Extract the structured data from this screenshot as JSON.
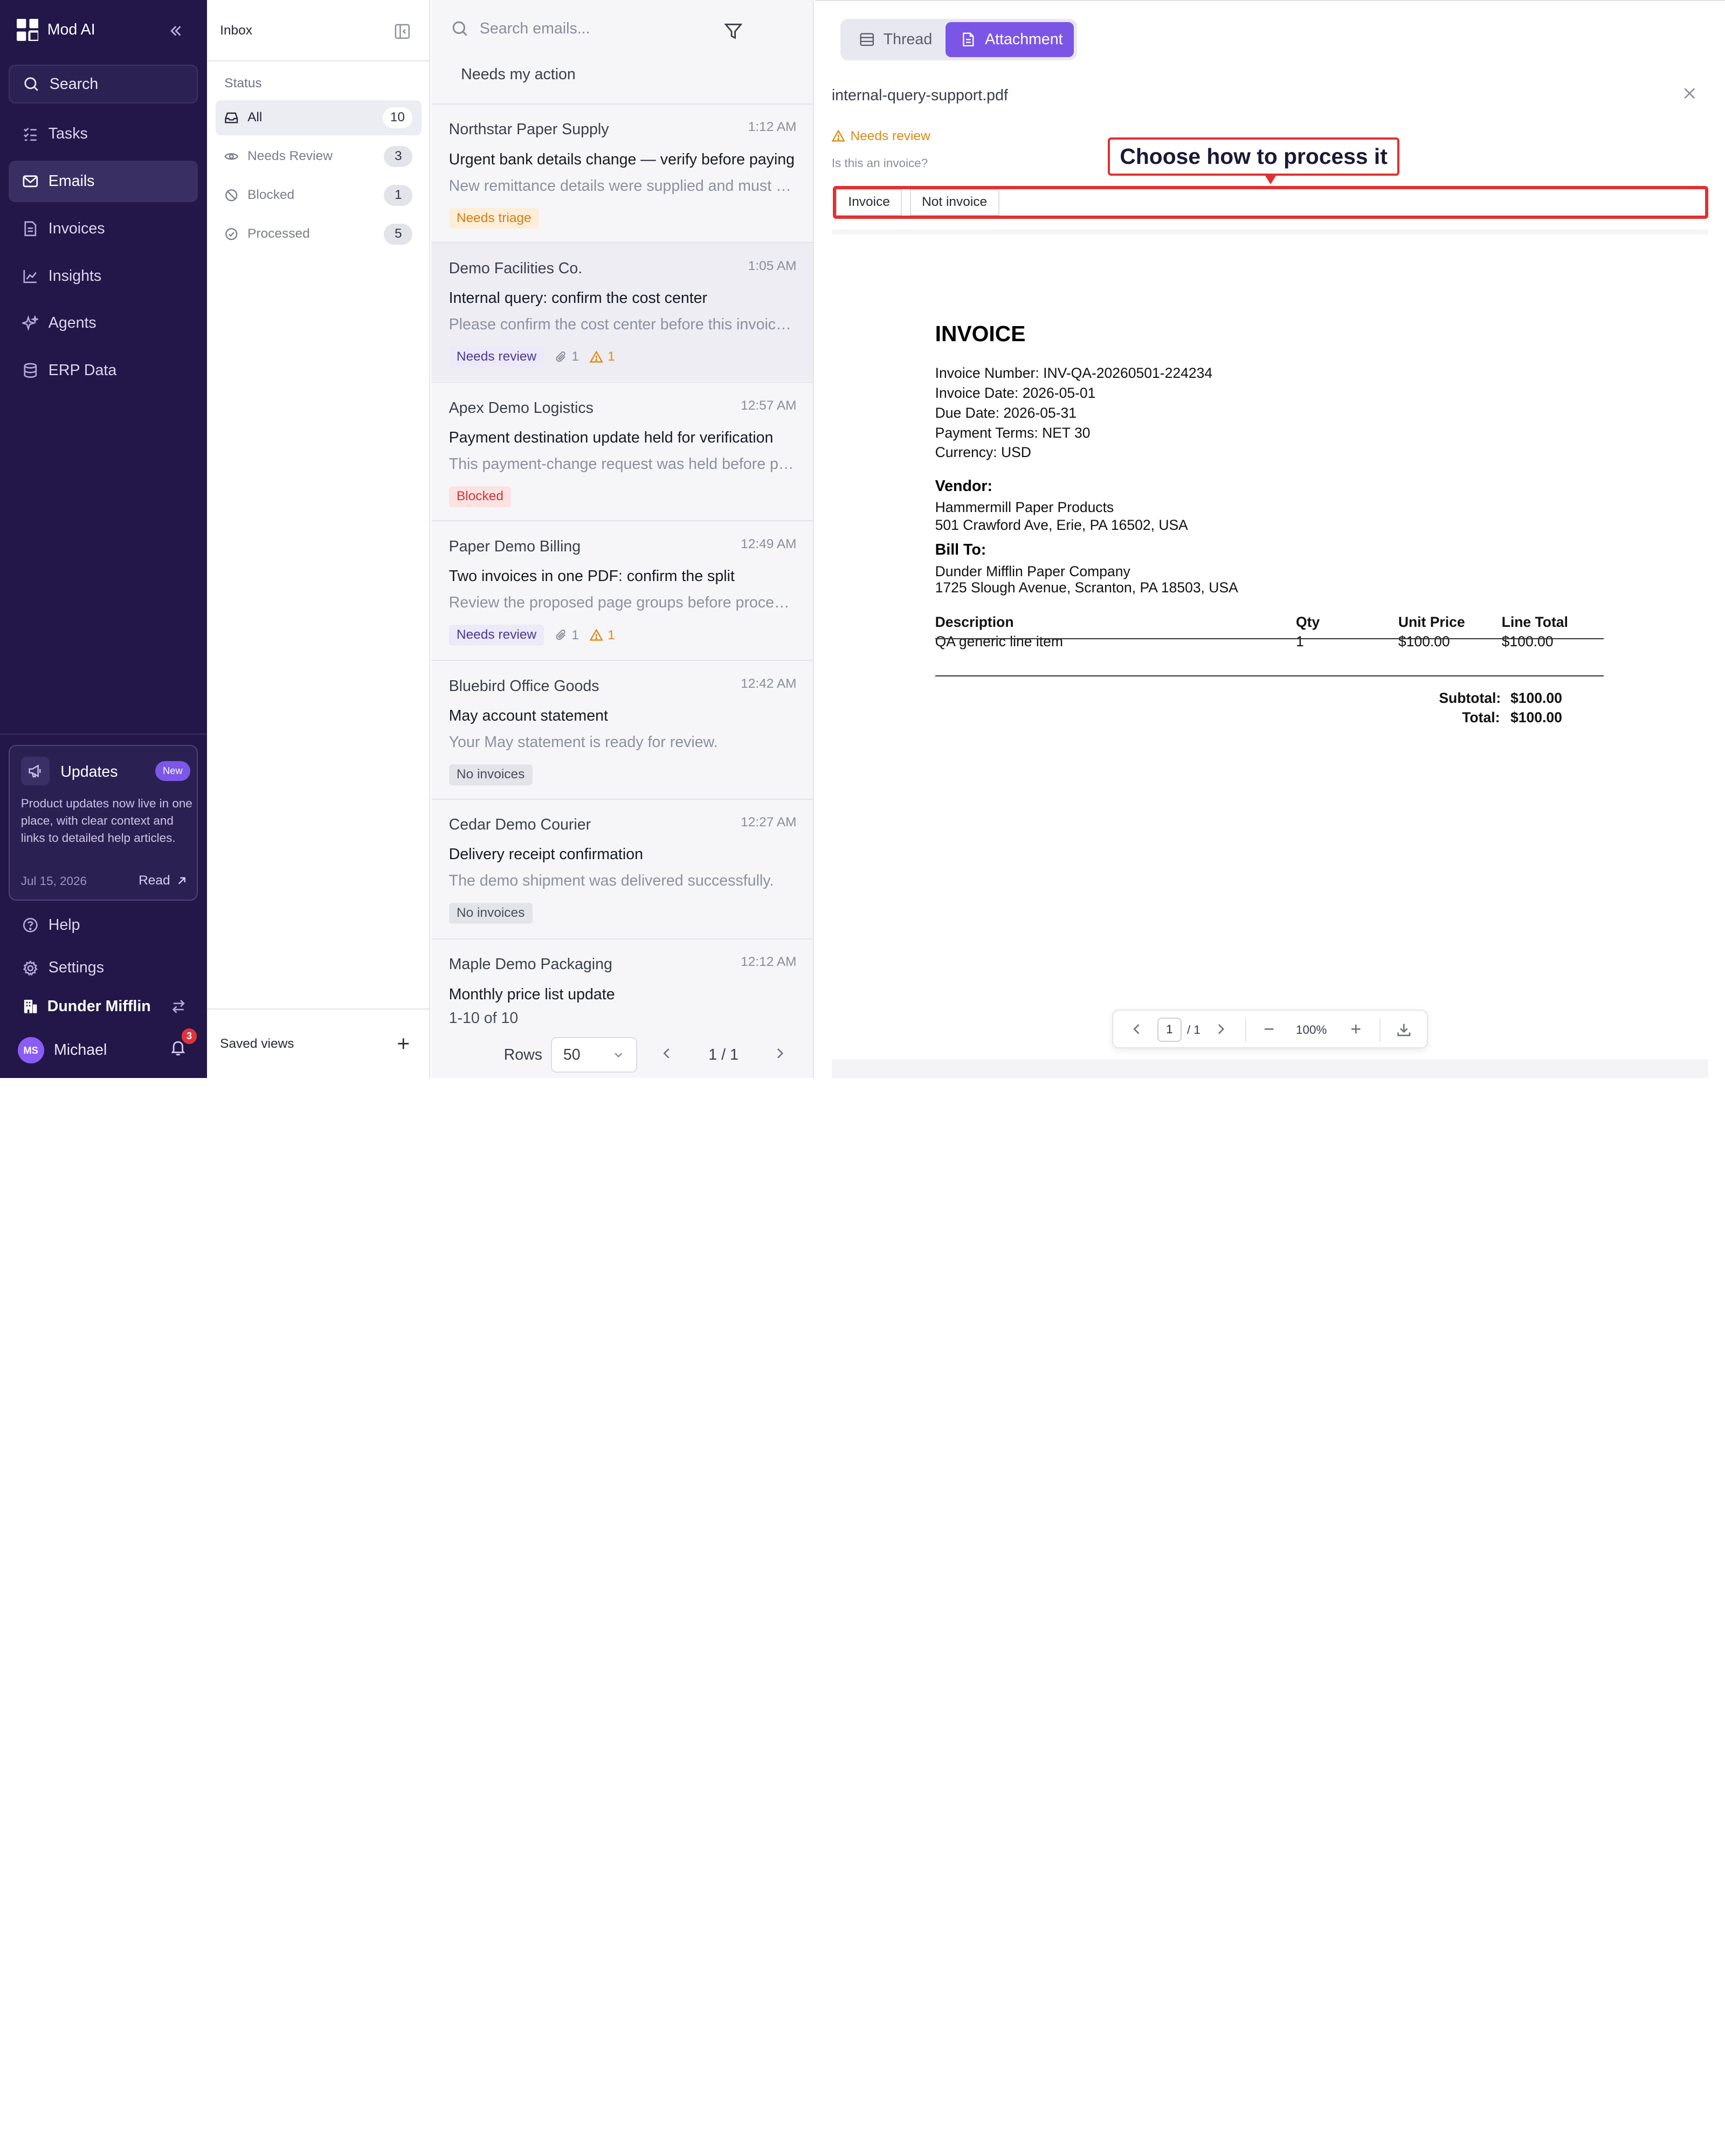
{
  "sidebar": {
    "brand": "Mod AI",
    "search_label": "Search",
    "nav": [
      {
        "label": "Tasks",
        "icon": "tasks-icon"
      },
      {
        "label": "Emails",
        "icon": "mail-icon",
        "active": true
      },
      {
        "label": "Invoices",
        "icon": "invoice-icon"
      },
      {
        "label": "Insights",
        "icon": "chart-line-icon"
      },
      {
        "label": "Agents",
        "icon": "sparkles-icon"
      },
      {
        "label": "ERP Data",
        "icon": "database-icon"
      }
    ],
    "updates": {
      "title": "Updates",
      "badge": "New",
      "text": "Product updates now live in one place, with clear context and links to detailed help articles.",
      "date": "Jul 15, 2026",
      "read_label": "Read"
    },
    "help_label": "Help",
    "settings_label": "Settings",
    "org_name": "Dunder Mifflin",
    "user": {
      "initials": "MS",
      "name": "Michael",
      "notifications": "3"
    }
  },
  "filter_panel": {
    "title": "Inbox",
    "section": "Status",
    "statuses": [
      {
        "label": "All",
        "count": "10",
        "icon": "inbox-icon",
        "active": true
      },
      {
        "label": "Needs Review",
        "count": "3",
        "icon": "eye-icon"
      },
      {
        "label": "Blocked",
        "count": "1",
        "icon": "ban-icon"
      },
      {
        "label": "Processed",
        "count": "5",
        "icon": "check-circle-icon"
      }
    ],
    "saved_views": "Saved views"
  },
  "email_list": {
    "search_placeholder": "Search emails...",
    "chip": "Needs my action",
    "emails": [
      {
        "sender": "Northstar Paper Supply",
        "time": "1:12 AM",
        "subject": "Urgent bank details change — verify before paying",
        "preview": "New remittance details were supplied and must be verified before any payment is released.",
        "tag": "Needs triage",
        "tag_type": "triage"
      },
      {
        "sender": "Demo Facilities Co.",
        "time": "1:05 AM",
        "subject": "Internal query: confirm the cost center",
        "preview": "Please confirm the cost center before this invoice is approved for payment.",
        "tag": "Needs review",
        "tag_type": "review",
        "attachments": "1",
        "warnings": "1",
        "selected": true
      },
      {
        "sender": "Apex Demo Logistics",
        "time": "12:57 AM",
        "subject": "Payment destination update held for verification",
        "preview": "This payment-change request was held before processing for manual verification.",
        "tag": "Blocked",
        "tag_type": "blocked"
      },
      {
        "sender": "Paper Demo Billing",
        "time": "12:49 AM",
        "subject": "Two invoices in one PDF: confirm the split",
        "preview": "Review the proposed page groups before processing the invoices in this document.",
        "tag": "Needs review",
        "tag_type": "review",
        "attachments": "1",
        "warnings": "1"
      },
      {
        "sender": "Bluebird Office Goods",
        "time": "12:42 AM",
        "subject": "May account statement",
        "preview": "Your May statement is ready for review.",
        "tag": "No invoices",
        "tag_type": "noinv"
      },
      {
        "sender": "Cedar Demo Courier",
        "time": "12:27 AM",
        "subject": "Delivery receipt confirmation",
        "preview": "The demo shipment was delivered successfully.",
        "tag": "No invoices",
        "tag_type": "noinv"
      },
      {
        "sender": "Maple Demo Packaging",
        "time": "12:12 AM",
        "subject": "Monthly price list update",
        "preview": "",
        "tag": "",
        "tag_type": ""
      }
    ],
    "count_text": "1-10 of 10",
    "rows_label": "Rows",
    "rows_value": "50",
    "page_text": "1 / 1"
  },
  "detail": {
    "tabs": [
      {
        "label": "Thread",
        "icon": "thread-icon"
      },
      {
        "label": "Attachment",
        "icon": "document-icon",
        "active": true
      }
    ],
    "filename": "internal-query-support.pdf",
    "status": "Needs review",
    "question": "Is this an invoice?",
    "choice_invoice": "Invoice",
    "choice_not_invoice": "Not invoice",
    "callout": "Choose how to process it",
    "pdf": {
      "title": "INVOICE",
      "invoice_number": "Invoice Number: INV-QA-20260501-224234",
      "invoice_date": "Invoice Date: 2026-05-01",
      "due_date": "Due Date: 2026-05-31",
      "payment_terms": "Payment Terms: NET 30",
      "currency": "Currency: USD",
      "vendor_label": "Vendor:",
      "vendor_name": "Hammermill Paper Products",
      "vendor_address": "501 Crawford Ave, Erie, PA 16502, USA",
      "billto_label": "Bill To:",
      "billto_name": "Dunder Mifflin Paper Company",
      "billto_address": "1725 Slough Avenue, Scranton, PA 18503, USA",
      "columns": [
        "Description",
        "Qty",
        "Unit Price",
        "Line Total"
      ],
      "line": [
        "QA generic line item",
        "1",
        "$100.00",
        "$100.00"
      ],
      "subtotal_label": "Subtotal:",
      "subtotal_value": "$100.00",
      "total_label": "Total:",
      "total_value": "$100.00"
    },
    "viewer": {
      "page": "1",
      "page_total": "/ 1",
      "zoom": "100%"
    }
  }
}
